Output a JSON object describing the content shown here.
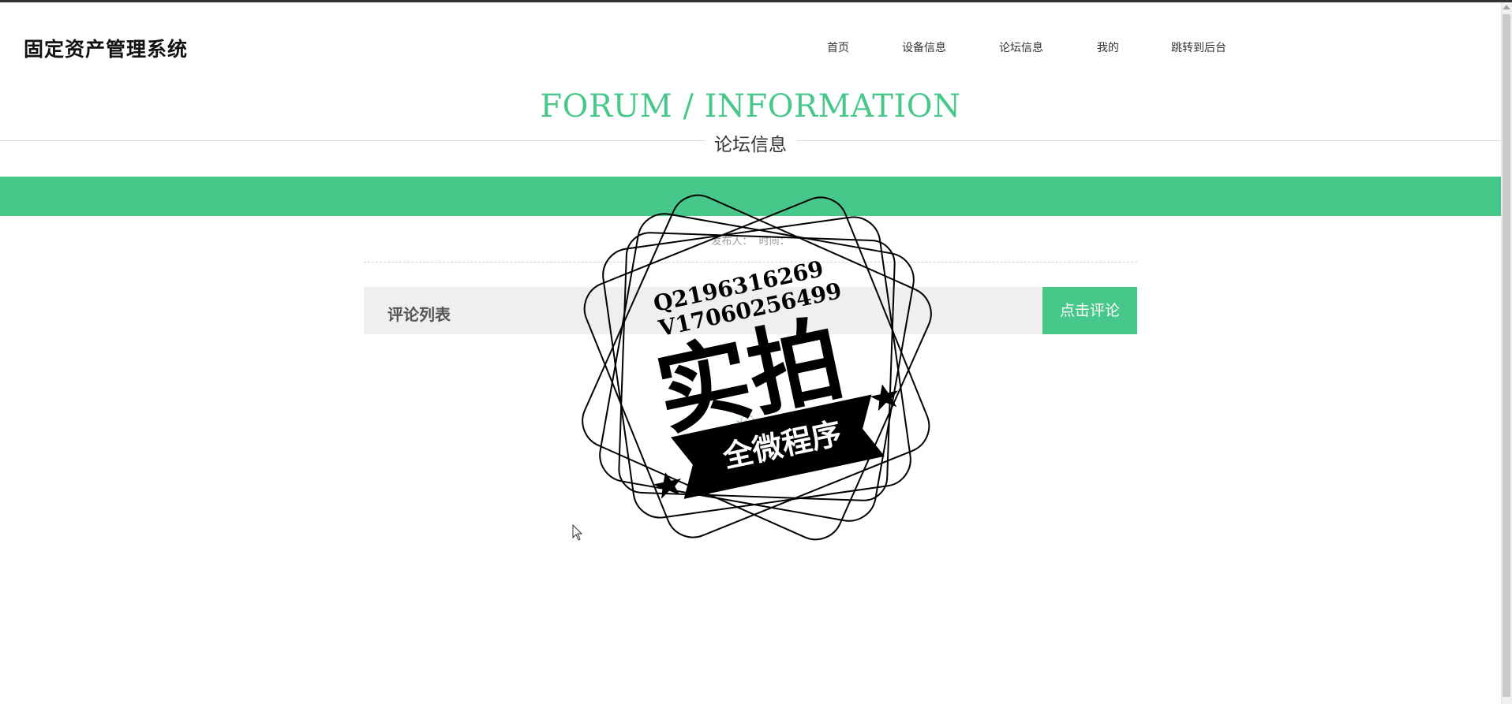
{
  "header": {
    "site_title": "固定资产管理系统",
    "nav": [
      {
        "label": "首页"
      },
      {
        "label": "设备信息"
      },
      {
        "label": "论坛信息"
      },
      {
        "label": "我的"
      },
      {
        "label": "跳转到后台"
      }
    ]
  },
  "section": {
    "title_en": "FORUM / INFORMATION",
    "title_cn": "论坛信息"
  },
  "post": {
    "publisher_label": "发布人：",
    "time_label": "时间："
  },
  "comments": {
    "list_title": "评论列表",
    "comment_button": "点击评论"
  },
  "watermark": {
    "line1": "Q2196316269",
    "line2": "V17060256499",
    "main_text": "实拍",
    "ribbon_text": "全微程序"
  },
  "colors": {
    "accent": "#48c78a",
    "watermark": "#000000"
  },
  "icons": {
    "loading": "loading-spinner-icon",
    "cursor": "mouse-pointer-icon"
  }
}
